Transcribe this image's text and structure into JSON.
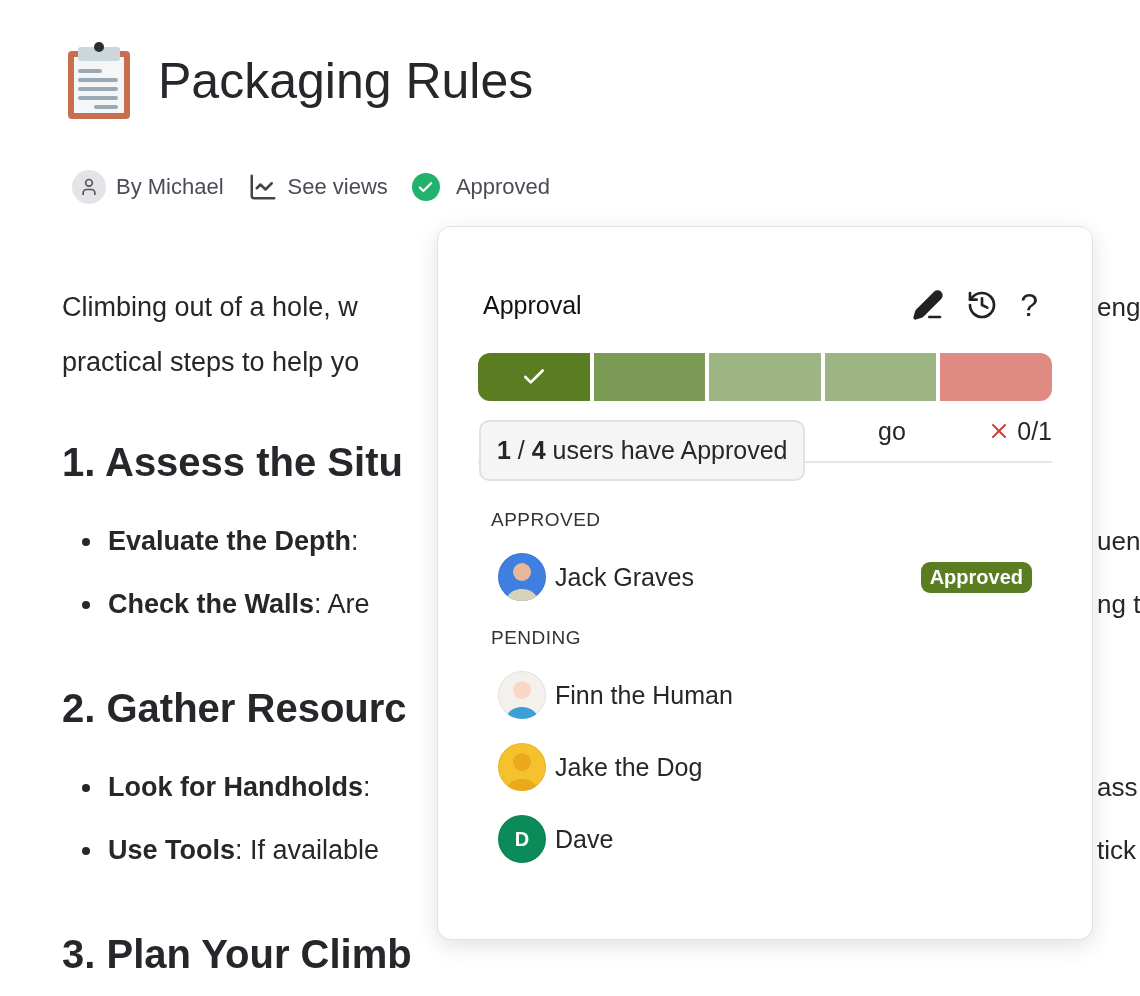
{
  "document": {
    "title": "Packaging Rules",
    "meta": [
      {
        "kind": "author",
        "label": "By Michael"
      },
      {
        "kind": "views",
        "label": "See views"
      },
      {
        "kind": "status",
        "label": "Approved"
      }
    ]
  },
  "article": [
    {
      "kind": "paragraph",
      "left": "Climbing out of a hole, w",
      "right": "eng"
    },
    {
      "kind": "paragraph",
      "left": "practical steps to help yo"
    },
    {
      "kind": "heading",
      "left": "1. Assess the Situ"
    },
    {
      "kind": "bullet",
      "left": "**Evaluate the Depth**:",
      "right": "uen"
    },
    {
      "kind": "bullet",
      "left": "**Check the Walls**: Are",
      "right": "ng t"
    },
    {
      "kind": "heading",
      "left": "2. Gather Resourc"
    },
    {
      "kind": "bullet",
      "left": "**Look for Handholds**:",
      "right": "ass"
    },
    {
      "kind": "bullet",
      "left": "**Use Tools**: If available",
      "right": "tick"
    },
    {
      "kind": "heading",
      "left": "3. Plan Your Climb"
    }
  ],
  "approval_popover": {
    "title": "Approval",
    "help": "?",
    "segments": [
      {
        "color": "#5a7d22",
        "checked": true
      },
      {
        "color": "#7a9a55",
        "checked": false
      },
      {
        "color": "#9db582",
        "checked": false
      },
      {
        "color": "#9db582",
        "checked": false
      },
      {
        "color": "#e08a84",
        "checked": false
      }
    ],
    "summary": {
      "visible_text": "go",
      "rejected": "0/1"
    },
    "tooltip": "**1** / **4** users have Approved",
    "groups": [
      {
        "heading": "APPROVED",
        "users": [
          {
            "name": "Jack Graves",
            "kind": "photo",
            "badge": "Approved"
          }
        ]
      },
      {
        "heading": "PENDING",
        "users": [
          {
            "name": "Finn the Human",
            "kind": "white"
          },
          {
            "name": "Jake the Dog",
            "kind": "yellow"
          },
          {
            "name": "Dave",
            "kind": "initial",
            "initial": "D"
          }
        ]
      }
    ]
  }
}
